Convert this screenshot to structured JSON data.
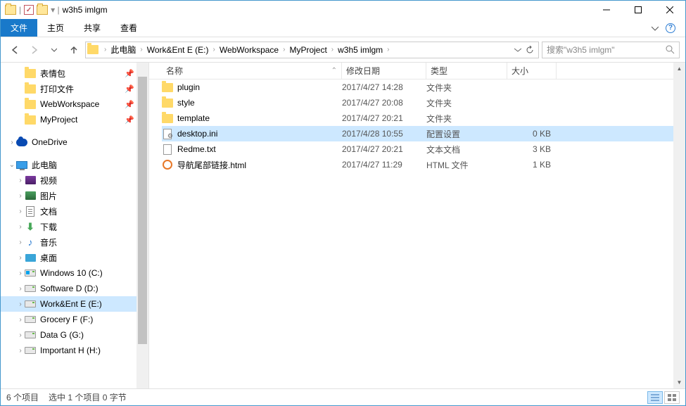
{
  "title": "w3h5 imlgm",
  "ribbon": {
    "file": "文件",
    "home": "主页",
    "share": "共享",
    "view": "查看"
  },
  "breadcrumb": {
    "c0": "此电脑",
    "c1": "Work&Ent E (E:)",
    "c2": "WebWorkspace",
    "c3": "MyProject",
    "c4": "w3h5 imlgm"
  },
  "search_placeholder": "搜索\"w3h5 imlgm\"",
  "sidebar": {
    "quick0": "表情包",
    "quick1": "打印文件",
    "quick2": "WebWorkspace",
    "quick3": "MyProject",
    "onedrive": "OneDrive",
    "thispc": "此电脑",
    "videos": "视频",
    "pictures": "图片",
    "documents": "文档",
    "downloads": "下载",
    "music": "音乐",
    "desktop": "桌面",
    "drive_c": "Windows 10 (C:)",
    "drive_d": "Software D (D:)",
    "drive_e": "Work&Ent E (E:)",
    "drive_f": "Grocery F (F:)",
    "drive_g": "Data G (G:)",
    "drive_h": "Important H (H:)"
  },
  "columns": {
    "name": "名称",
    "date": "修改日期",
    "type": "类型",
    "size": "大小"
  },
  "files": {
    "r0": {
      "name": "plugin",
      "date": "2017/4/27 14:28",
      "type": "文件夹",
      "size": ""
    },
    "r1": {
      "name": "style",
      "date": "2017/4/27 20:08",
      "type": "文件夹",
      "size": ""
    },
    "r2": {
      "name": "template",
      "date": "2017/4/27 20:21",
      "type": "文件夹",
      "size": ""
    },
    "r3": {
      "name": "desktop.ini",
      "date": "2017/4/28 10:55",
      "type": "配置设置",
      "size": "0 KB"
    },
    "r4": {
      "name": "Redme.txt",
      "date": "2017/4/27 20:21",
      "type": "文本文档",
      "size": "3 KB"
    },
    "r5": {
      "name": "导航尾部链接.html",
      "date": "2017/4/27 11:29",
      "type": "HTML 文件",
      "size": "1 KB"
    }
  },
  "status": {
    "count": "6 个项目",
    "selection": "选中 1 个项目  0 字节"
  }
}
